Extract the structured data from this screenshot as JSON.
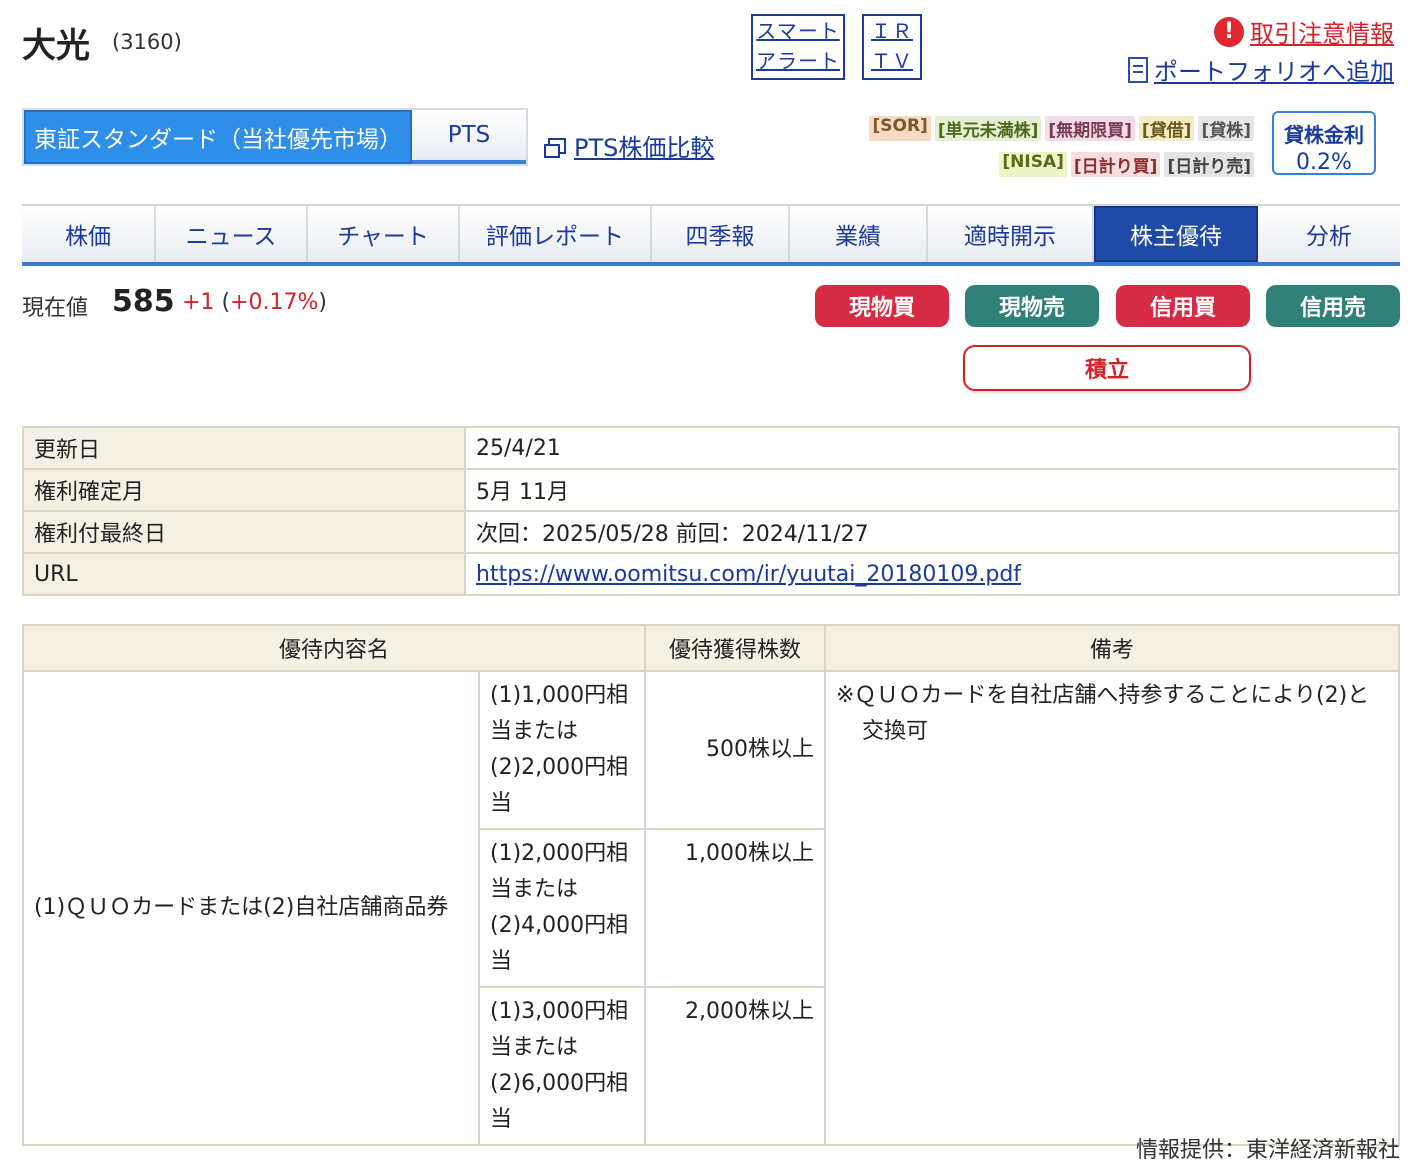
{
  "header": {
    "name": "大光",
    "code": "(3160)",
    "smart_alert": "スマートアラート",
    "ir_tv": "ＩＲＴＶ",
    "caution_link": "取引注意情報",
    "portfolio_link": "ポートフォリオへ追加"
  },
  "market_tabs": {
    "tse": "東証スタンダード（当社優先市場）",
    "pts": "PTS"
  },
  "pts_compare": "PTS株価比較",
  "badges_row1": [
    "[SOR]",
    "[単元未満株]",
    "[無期限買]",
    "[貸借]",
    "[貸株]"
  ],
  "badges_row2": [
    "[NISA]",
    "[日計り買]",
    "[日計り売]"
  ],
  "lending_rate": {
    "label": "貸株金利",
    "value": "0.2%"
  },
  "nav": [
    "株価",
    "ニュース",
    "チャート",
    "評価レポート",
    "四季報",
    "業績",
    "適時開示",
    "株主優待",
    "分析"
  ],
  "price": {
    "label": "現在値",
    "value": "585",
    "change": "+1",
    "change_pct": "+0.17%"
  },
  "buttons": {
    "spot_buy": "現物買",
    "spot_sell": "現物売",
    "margin_buy": "信用買",
    "margin_sell": "信用売",
    "accumulate": "積立"
  },
  "info": {
    "updated_label": "更新日",
    "updated_value": "25/4/21",
    "record_month_label": "権利確定月",
    "record_month_value": "5月 11月",
    "last_day_label": "権利付最終日",
    "last_day_value": "次回：2025/05/28 前回：2024/11/27",
    "url_label": "URL",
    "url_value": "https://www.oomitsu.com/ir/yuutai_20180109.pdf"
  },
  "benefits": {
    "headers": [
      "優待内容名",
      "優待獲得株数",
      "備考"
    ],
    "name": "(1)ＱＵＯカードまたは(2)自社店舗商品券",
    "rows": [
      {
        "amount": "(1)1,000円相当または(2)2,000円相当",
        "shares": "500株以上"
      },
      {
        "amount": "(1)2,000円相当または(2)4,000円相当",
        "shares": "1,000株以上"
      },
      {
        "amount": "(1)3,000円相当または(2)6,000円相当",
        "shares": "2,000株以上"
      }
    ],
    "note": "※ＱＵＯカードを自社店舗へ持参することにより(2)と交換可"
  },
  "provider": "情報提供：東洋経済新報社",
  "colors": {
    "accent_blue": "#1f4aa8",
    "buy_red": "#d62b45",
    "sell_teal": "#2f8077",
    "table_header_bg": "#f4f1e4"
  }
}
